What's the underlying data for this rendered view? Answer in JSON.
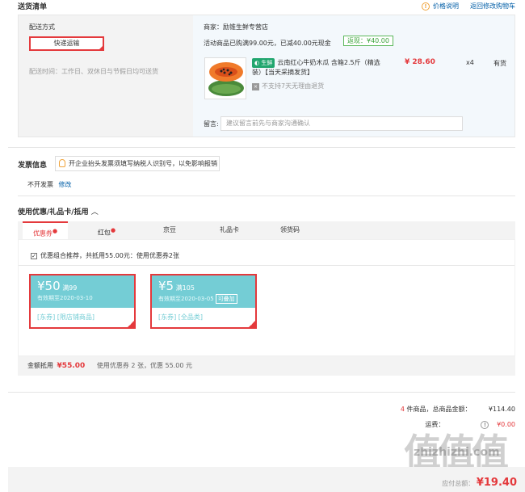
{
  "header": {
    "title": "送货清单",
    "price_info_link": "价格说明",
    "return_cart_link": "返回修改购物车"
  },
  "delivery": {
    "method_label": "配送方式",
    "method_button": "快递运输",
    "time_label": "配送时间：工作日、双休日与节假日均可送货"
  },
  "store": {
    "name": "商家：励锥生鲜专营店",
    "promo_text": "活动商品已购满99.00元，已减40.00元现金",
    "promo_tag": "返现：¥40.00",
    "product": {
      "badge": "生鲜",
      "name": "云南红心牛奶木瓜 含箱2.5斤（精选装）【当天采摘发货】",
      "return_note": "不支持7天无理由退货",
      "price": "¥ 28.60",
      "qty": "x4",
      "stock": "有货"
    },
    "remark_label": "留言:",
    "remark_placeholder": "建议留言前先与商家沟通确认"
  },
  "invoice": {
    "title": "发票信息",
    "tip": "开企业抬头发票须填写纳税人识别号，以免影响报销",
    "value": "不开发票",
    "edit_link": "修改"
  },
  "coupon_section": {
    "title": "使用优惠/礼品卡/抵用",
    "tabs": [
      {
        "label": "优惠券",
        "dot": "●"
      },
      {
        "label": "红包",
        "dot": "●"
      },
      {
        "label": "京豆",
        "dot": ""
      },
      {
        "label": "礼品卡",
        "dot": ""
      },
      {
        "label": "领货码",
        "dot": ""
      }
    ],
    "recommend_text": "优惠组合推荐，共抵用55.00元：使用优惠券2张",
    "coupons": [
      {
        "amount": "¥50",
        "condition": "满99",
        "validity": "有效期至2020-03-10",
        "tags": "[东券] [限店铺商品]",
        "stackable": ""
      },
      {
        "amount": "¥5",
        "condition": "满105",
        "validity": "有效期至2020-03-05",
        "tags": "[东券] [全品类]",
        "stackable": "可叠加"
      }
    ],
    "summary_label": "金额抵用",
    "summary_amount": "¥55.00",
    "summary_detail": "使用优惠券 2 张，优惠 55.00 元"
  },
  "totals": {
    "count": "4",
    "count_label": "件商品，总商品金额：",
    "goods_amount": "¥114.40",
    "freight_label": "运费：",
    "freight_value": "¥0.00",
    "payable_label": "应付总额：",
    "payable_value": "¥19.40"
  },
  "watermark": {
    "logo": "值值值",
    "site": "zhizhizhi.com"
  },
  "colors": {
    "accent_red": "#e4393c",
    "link_blue": "#005ea7",
    "coupon_teal": "#74cdd5",
    "promo_green": "#3ba33b"
  }
}
